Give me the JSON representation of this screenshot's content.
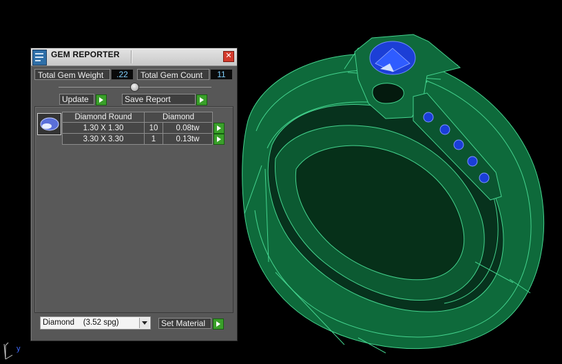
{
  "panel": {
    "title": "GEM REPORTER",
    "close_glyph": "✕",
    "total_gem_weight_label": "Total Gem Weight",
    "total_gem_weight_value": ".22",
    "total_gem_count_label": "Total Gem Count",
    "total_gem_count_value": "11",
    "update_label": "Update",
    "save_report_label": "Save Report",
    "table": {
      "header_shape": "Diamond Round",
      "header_material": "Diamond",
      "rows": [
        {
          "size": "1.30 X 1.30",
          "count": "10",
          "weight": "0.08tw"
        },
        {
          "size": "3.30 X 3.30",
          "count": "1",
          "weight": "0.13tw"
        }
      ]
    },
    "material_selected": "Diamond    (3.52 spg)",
    "set_material_label": "Set Material"
  },
  "axis": {
    "y_label": "y"
  },
  "colors": {
    "metal": "#0f6a3c",
    "wire": "#3fd08a",
    "gem": "#1a3ed8",
    "panel_bg": "#575757"
  }
}
